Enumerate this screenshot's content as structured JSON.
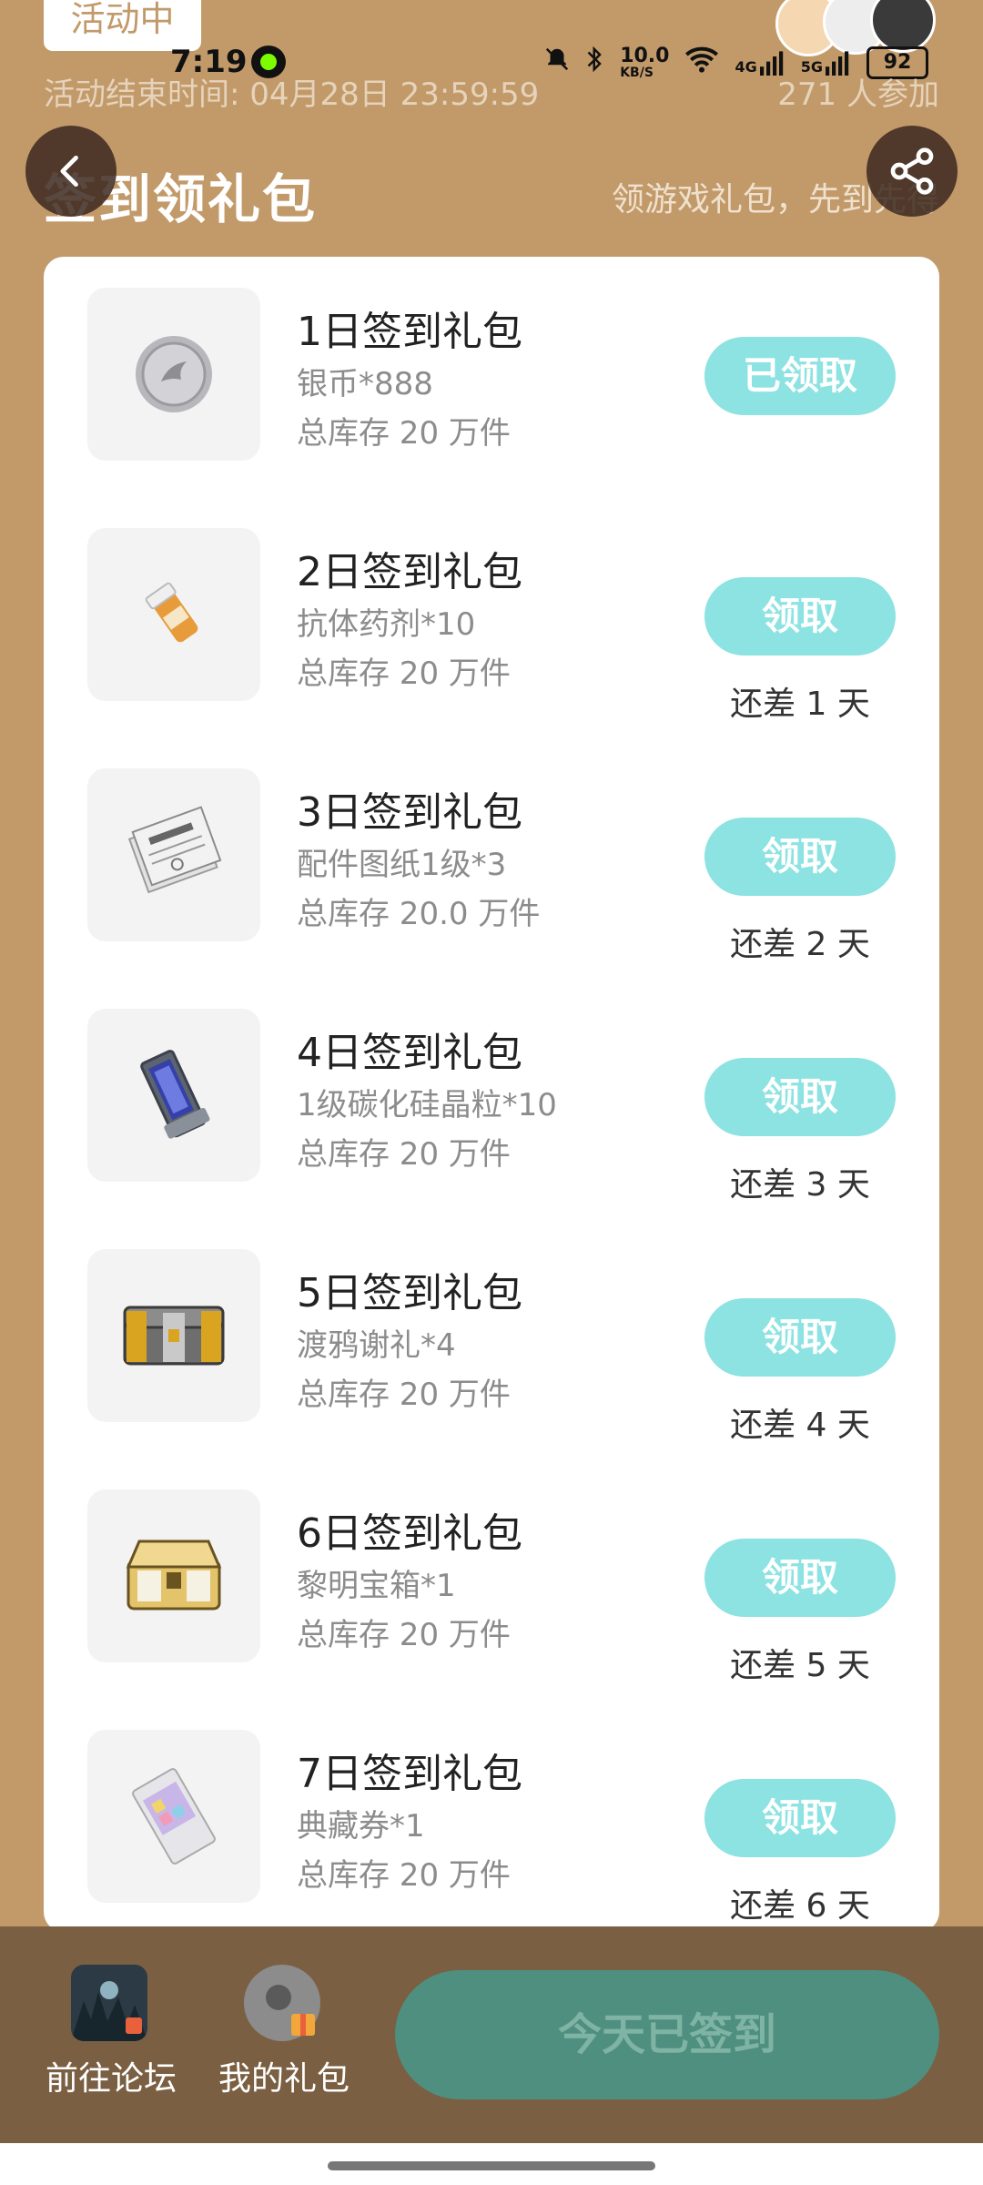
{
  "status_bar": {
    "time": "7:19",
    "network_speed": "10.0",
    "network_unit": "KB/S",
    "network_4g": "4G",
    "network_5g": "5G",
    "battery": "92"
  },
  "header": {
    "activity_tag": "活动中",
    "end_time": "活动结束时间: 04月28日 23:59:59",
    "participants": "271 人参加",
    "title": "签到领礼包",
    "subtitle": "领游戏礼包，先到先得"
  },
  "gifts": [
    {
      "title": "1日签到礼包",
      "reward": "银币*888",
      "stock": "总库存 20 万件",
      "button": "已领取",
      "remaining": "",
      "icon": "silver-coin-icon"
    },
    {
      "title": "2日签到礼包",
      "reward": "抗体药剂*10",
      "stock": "总库存 20 万件",
      "button": "领取",
      "remaining": "还差 1 天",
      "icon": "antibody-bottle-icon"
    },
    {
      "title": "3日签到礼包",
      "reward": "配件图纸1级*3",
      "stock": "总库存 20.0 万件",
      "button": "领取",
      "remaining": "还差 2 天",
      "icon": "blueprint-papers-icon"
    },
    {
      "title": "4日签到礼包",
      "reward": "1级碳化硅晶粒*10",
      "stock": "总库存 20 万件",
      "button": "领取",
      "remaining": "还差 3 天",
      "icon": "silicon-crystal-icon"
    },
    {
      "title": "5日签到礼包",
      "reward": "渡鸦谢礼*4",
      "stock": "总库存 20 万件",
      "button": "领取",
      "remaining": "还差 4 天",
      "icon": "raven-chest-icon"
    },
    {
      "title": "6日签到礼包",
      "reward": "黎明宝箱*1",
      "stock": "总库存 20 万件",
      "button": "领取",
      "remaining": "还差 5 天",
      "icon": "dawn-chest-icon"
    },
    {
      "title": "7日签到礼包",
      "reward": "典藏券*1",
      "stock": "总库存 20 万件",
      "button": "领取",
      "remaining": "还差 6 天",
      "icon": "collection-ticket-icon"
    }
  ],
  "bottom_bar": {
    "forum_label": "前往论坛",
    "my_gifts_label": "我的礼包",
    "signed_label": "今天已签到"
  },
  "colors": {
    "background": "#C29A6A",
    "claim_button": "#8DE2E2",
    "bottom_bar": "#7A5F42",
    "signed_button": "#4E8F80"
  }
}
